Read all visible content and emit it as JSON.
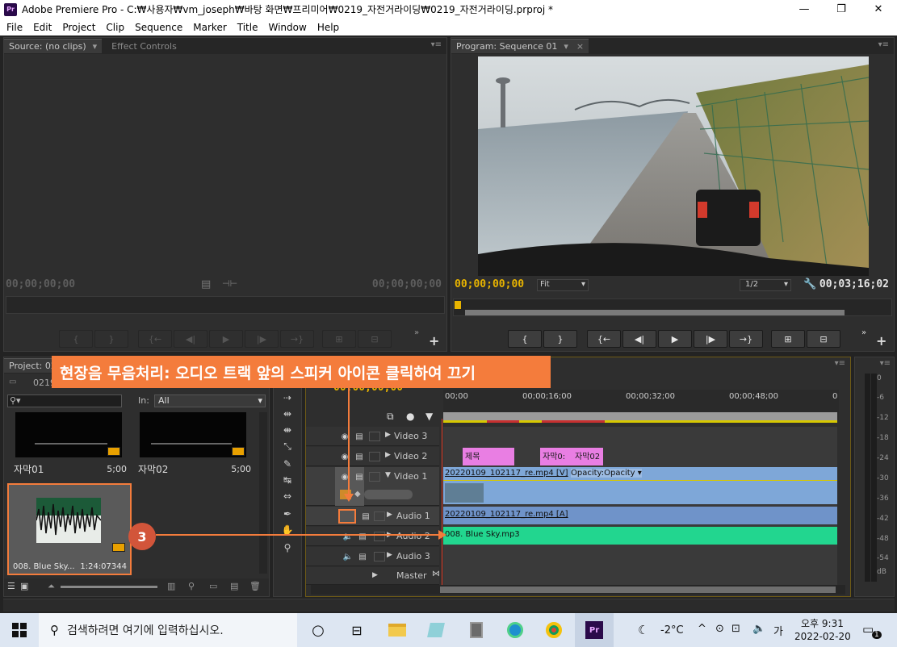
{
  "titlebar": {
    "app_icon": "Pr",
    "title": "Adobe Premiere Pro - C:₩사용자₩vm_joseph₩바탕 화면₩프리미어₩0219_자전거라이딩₩0219_자전거라이딩.prproj *",
    "minimize_icon": "—",
    "restore_icon": "❐",
    "close_icon": "✕"
  },
  "menu": [
    "File",
    "Edit",
    "Project",
    "Clip",
    "Sequence",
    "Marker",
    "Title",
    "Window",
    "Help"
  ],
  "source_panel": {
    "tab_source": "Source: (no clips)",
    "tab_effect_controls": "Effect Controls",
    "timecode_left": "00;00;00;00",
    "timecode_right": "00;00;00;00"
  },
  "program_panel": {
    "tab": "Program: Sequence 01",
    "timecode_left": "00;00;00;00",
    "fit": "Fit",
    "resolution": "1/2",
    "timecode_right": "00;03;16;02"
  },
  "project_panel": {
    "tab": "Project: 02",
    "item_count": "0219",
    "in_label": "In:",
    "in_value": "All",
    "items": [
      {
        "name": "자막01",
        "duration": "5;00"
      },
      {
        "name": "자막02",
        "duration": "5;00"
      },
      {
        "name": "008. Blue Sky...",
        "duration": "1:24:07344"
      }
    ]
  },
  "timeline": {
    "timecode": "00;00;00;00",
    "ruler": [
      "00;00",
      "00;00;16;00",
      "00;00;32;00",
      "00;00;48;00",
      "0"
    ],
    "tracks": {
      "video3": "Video 3",
      "video2": "Video 2",
      "video1": "Video 1",
      "audio1": "Audio 1",
      "audio2": "Audio 2",
      "audio3": "Audio 3",
      "master": "Master"
    },
    "clips": {
      "title1": "제목",
      "sub1": "자막0:",
      "sub2": "자막02",
      "v1_clip": "20220109_102117_re.mp4 [V]",
      "opacity": "Opacity:Opacity ▾",
      "a1_clip": "20220109_102117_re.mp4 [A]",
      "a2_clip": "008. Blue Sky.mp3"
    }
  },
  "meter": {
    "labels": [
      "0",
      "-6",
      "-12",
      "-18",
      "-24",
      "-30",
      "-36",
      "-42",
      "-48",
      "-54",
      "dB"
    ]
  },
  "annotation": {
    "banner": "현장음 무음처리: 오디오 트랙 앞의 스피커 아이콘 클릭하여 끄기",
    "step": "3"
  },
  "taskbar": {
    "search_placeholder": "검색하려면 여기에 입력하십시오.",
    "weather": "-2°C",
    "ime": "가",
    "time": "오후 9:31",
    "date": "2022-02-20",
    "notification_count": "1"
  },
  "colors": {
    "accent_orange": "#f47c3c",
    "timecode_yellow": "#e8b400",
    "clip_video_blue": "#7ea7d8",
    "clip_audio_blue": "#6f93c9",
    "clip_audio_green": "#22d68f",
    "clip_title_pink": "#e97ee3"
  }
}
